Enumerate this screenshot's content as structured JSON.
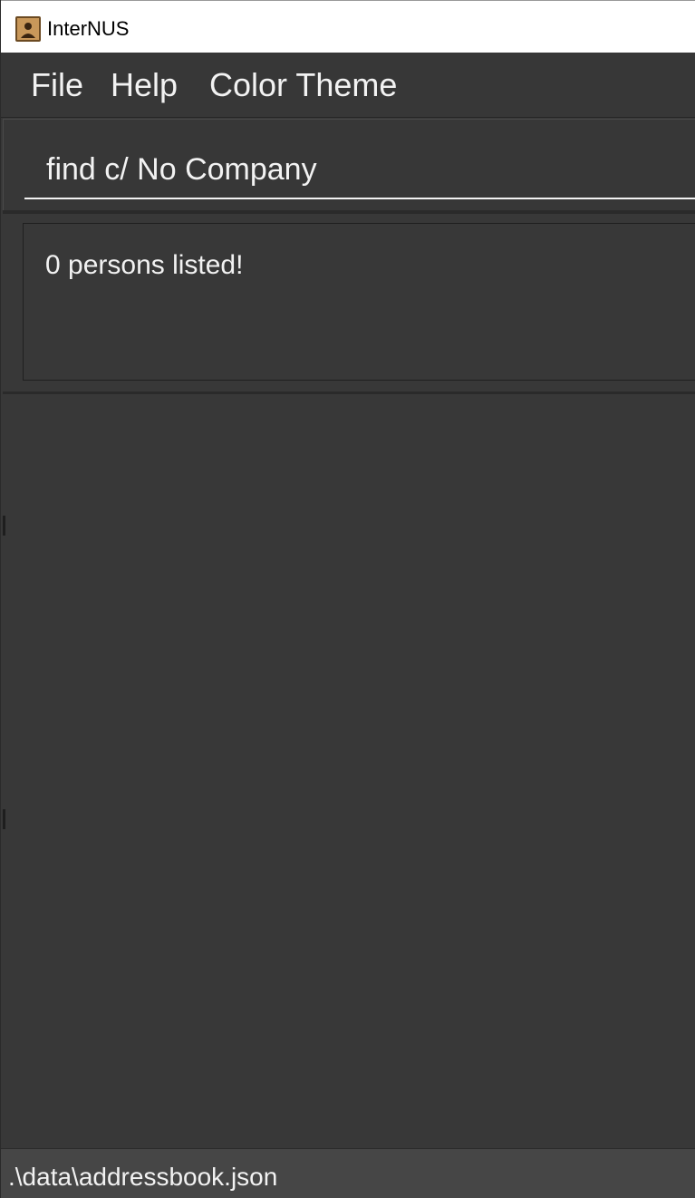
{
  "window": {
    "title": "InterNUS",
    "icon": "address-book-icon"
  },
  "menu": {
    "items": [
      {
        "label": "File"
      },
      {
        "label": "Help"
      },
      {
        "label": "Color Theme"
      }
    ]
  },
  "command_box": {
    "value": "find c/ No Company"
  },
  "result_display": {
    "message": "0 persons listed!"
  },
  "status_bar": {
    "file_path": ".\\data\\addressbook.json"
  },
  "colors": {
    "background": "#383838",
    "menu_bar": "#373737",
    "status_bar": "#464646",
    "text": "#f2f2f2"
  }
}
